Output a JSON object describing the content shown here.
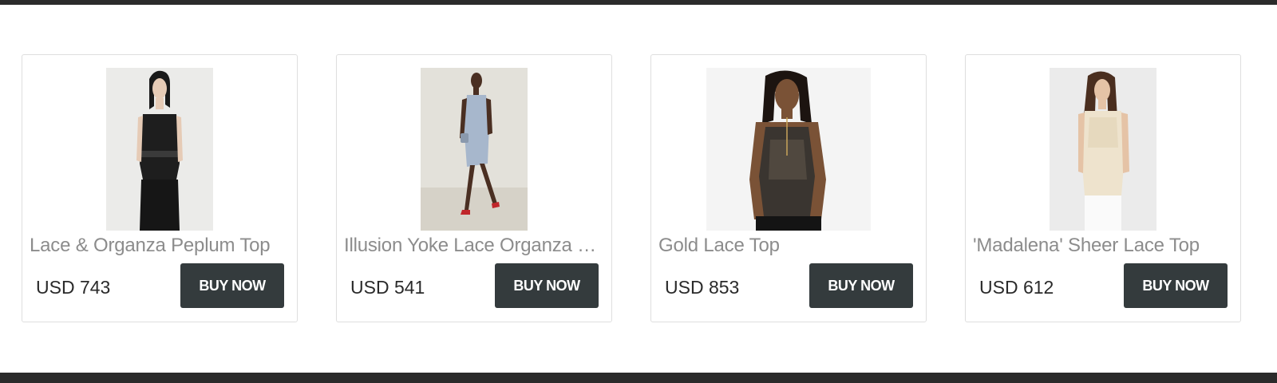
{
  "products": [
    {
      "title": "Lace & Organza Peplum Top",
      "price": "USD 743",
      "button_label": "BUY NOW",
      "image_icon": "woman-black-peplum-top-photo",
      "colors": {
        "garment": "#1e1e1e",
        "bg": "#ebebe9"
      }
    },
    {
      "title": "Illusion Yoke Lace Organza Dress",
      "price": "USD 541",
      "button_label": "BUY NOW",
      "image_icon": "woman-light-blue-lace-dress-photo",
      "colors": {
        "garment": "#a7b7cc",
        "bg": "#e3e1da"
      }
    },
    {
      "title": "Gold Lace Top",
      "price": "USD 853",
      "button_label": "BUY NOW",
      "image_icon": "woman-gold-lace-top-photo",
      "colors": {
        "garment": "#3a3530",
        "bg": "#f4f4f4"
      }
    },
    {
      "title": "'Madalena' Sheer Lace Top",
      "price": "USD 612",
      "button_label": "BUY NOW",
      "image_icon": "woman-cream-lace-top-photo",
      "colors": {
        "garment": "#eee3cd",
        "bg": "#ebebeb"
      }
    }
  ],
  "colors": {
    "bar": "#2b2b2b",
    "button_bg": "#343b3d",
    "title_text": "#8c8c8c",
    "price_text": "#2a2a2a"
  }
}
